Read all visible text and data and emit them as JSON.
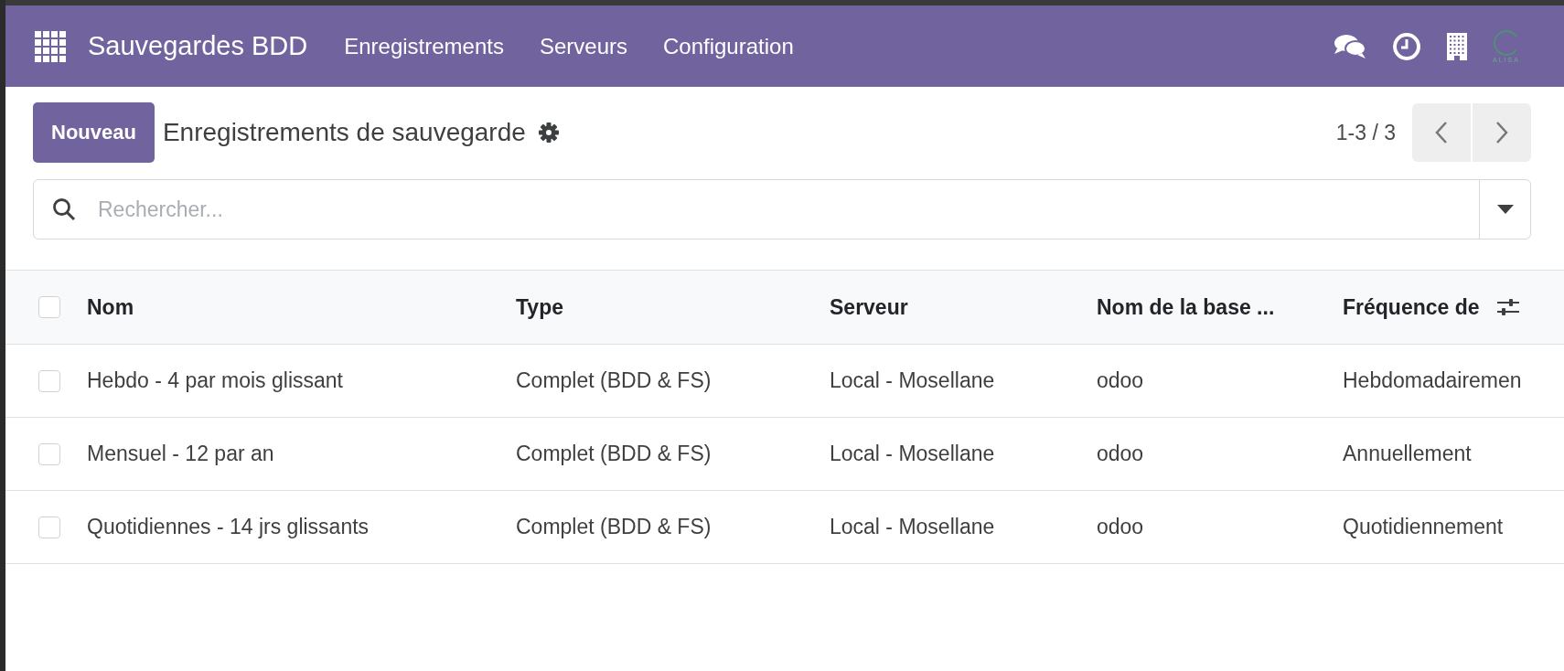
{
  "navbar": {
    "app_name": "Sauvegardes BDD",
    "menu": [
      {
        "label": "Enregistrements"
      },
      {
        "label": "Serveurs"
      },
      {
        "label": "Configuration"
      }
    ],
    "logo_text": "ALISA"
  },
  "control_panel": {
    "new_button": "Nouveau",
    "title": "Enregistrements de sauvegarde",
    "pager": "1-3 / 3"
  },
  "search": {
    "placeholder": "Rechercher..."
  },
  "table": {
    "select_all": {
      "checked": false
    },
    "columns": [
      "Nom",
      "Type",
      "Serveur",
      "Nom de la base ...",
      "Fréquence de"
    ],
    "rows": [
      {
        "checked": false,
        "cells": [
          "Hebdo - 4 par mois glissant",
          "Complet (BDD & FS)",
          "Local - Mosellane",
          "odoo",
          "Hebdomadairemen"
        ]
      },
      {
        "checked": false,
        "cells": [
          "Mensuel - 12 par an",
          "Complet (BDD & FS)",
          "Local - Mosellane",
          "odoo",
          "Annuellement"
        ]
      },
      {
        "checked": false,
        "cells": [
          "Quotidiennes - 14 jrs glissants",
          "Complet (BDD & FS)",
          "Local - Mosellane",
          "odoo",
          "Quotidiennement"
        ]
      }
    ]
  }
}
